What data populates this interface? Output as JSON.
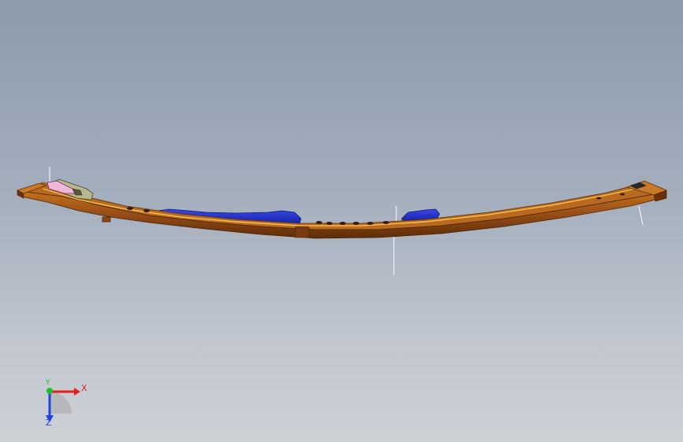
{
  "viewport": {
    "background_top": "#8c9aac",
    "background_bottom": "#cdd0d5"
  },
  "model": {
    "name": "curved-rail-assembly",
    "colors": {
      "rail_main": "#a0551c",
      "rail_dark": "#5c2c08",
      "rail_edge": "#f0b040",
      "blue_part": "#2030c8",
      "bracket": "#b8b890",
      "pink_part": "#f0b8d8"
    }
  },
  "triad": {
    "x_label": "X",
    "y_label": "Y",
    "z_label": "Z",
    "x_color": "#e02020",
    "y_color": "#20c020",
    "z_color": "#2040e0"
  }
}
